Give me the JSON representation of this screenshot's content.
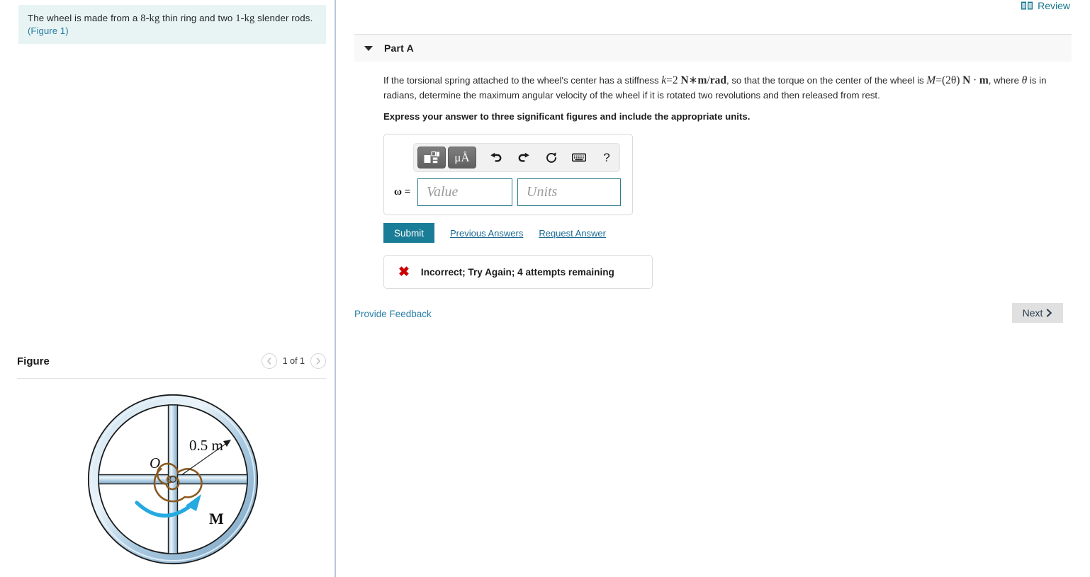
{
  "problem": {
    "statement_pre": "The wheel is made from a ",
    "mass_ring": "8-kg",
    "statement_mid": " thin ring and two ",
    "mass_rod": "1-kg",
    "statement_post": " slender rods.",
    "figure_link": "(Figure 1)"
  },
  "review": {
    "label": "Review",
    "icon": "book-icon"
  },
  "part": {
    "label": "Part A",
    "caret_icon": "caret-down-icon",
    "question": {
      "seg1": "If the torsional spring attached to the wheel's center has a stiffness ",
      "math_k": "k = 2 N ∗ m/rad",
      "k_var": "k",
      "k_eq": "=",
      "k_num": "2",
      "k_unit_n": "N",
      "k_ast": "∗",
      "k_unit_num": "m",
      "k_unit_den": "rad",
      "seg2": ", so that the torque on the center of the wheel is ",
      "m_var": "M",
      "m_eq": "=",
      "m_expr": "(2θ)",
      "m_unit_n": "N",
      "m_dot": "·",
      "m_unit_m": "m",
      "seg3": ", where ",
      "theta": "θ",
      "seg4": " is in radians, determine the maximum angular velocity of the wheel if it is rotated two revolutions and then released from rest."
    },
    "instruction": "Express your answer to three significant figures and include the appropriate units."
  },
  "toolbar": {
    "template_icon": "math-template-icon",
    "units_icon": "micro-angstrom-units-icon",
    "units_label": "μÅ",
    "undo_icon": "undo-icon",
    "redo_icon": "redo-icon",
    "reset_icon": "reset-icon",
    "keyboard_icon": "keyboard-icon",
    "help_icon": "help-icon",
    "help_label": "?"
  },
  "answer": {
    "variable_label": "ω =",
    "value_placeholder": "Value",
    "value": "",
    "units_placeholder": "Units",
    "units": ""
  },
  "actions": {
    "submit": "Submit",
    "previous_answers": "Previous Answers",
    "request_answer": "Request Answer"
  },
  "feedback": {
    "icon": "error-x-icon",
    "message": "Incorrect; Try Again; 4 attempts remaining"
  },
  "footer": {
    "provide_feedback": "Provide Feedback",
    "next": "Next",
    "next_icon": "chevron-right-icon"
  },
  "figure": {
    "title": "Figure",
    "prev_icon": "chevron-left-icon",
    "next_icon": "chevron-right-icon",
    "pager": "1 of 1",
    "diagram": {
      "center_label": "O",
      "radius_label": "0.5 m",
      "moment_label": "M",
      "rim_color": "#b6d2e6",
      "rim_edge_color": "#1b1b1b",
      "spring_color": "#8a5a22",
      "arrow_color": "#24a9e0"
    }
  },
  "colors": {
    "accent": "#1a7d97",
    "link": "#2a7fa8",
    "error": "#cc0000",
    "problem_bg": "#e7f4f3"
  }
}
